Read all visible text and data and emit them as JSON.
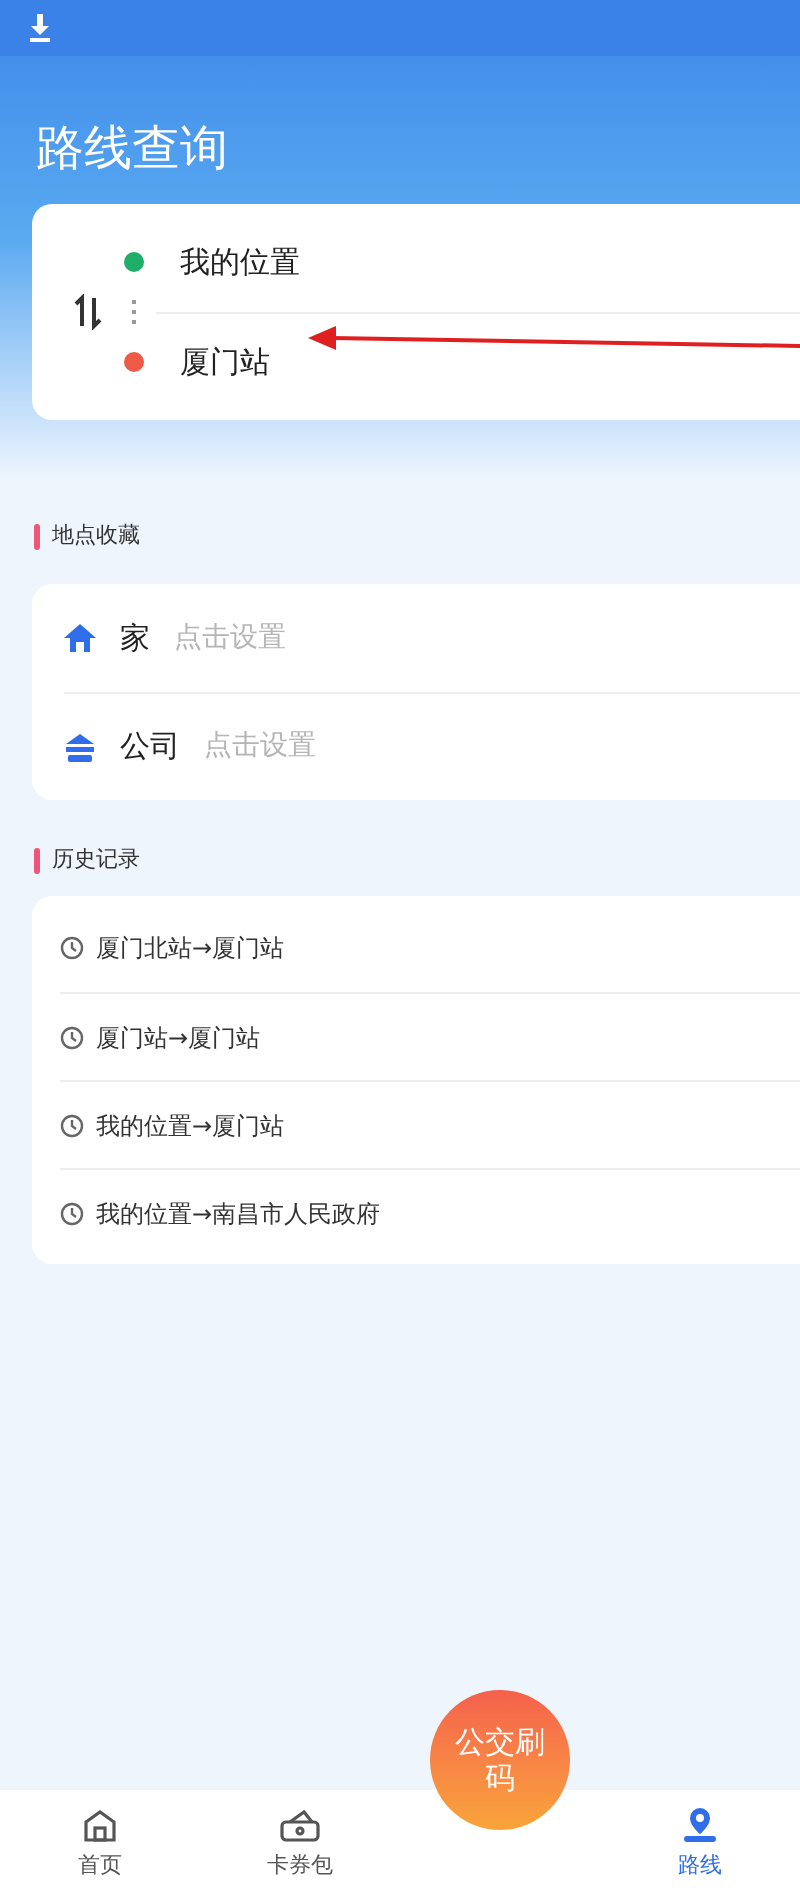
{
  "title": "路线查询",
  "route": {
    "from": "我的位置",
    "to": "厦门站"
  },
  "favorites": {
    "heading": "地点收藏",
    "items": [
      {
        "kind": "home",
        "label": "家",
        "placeholder": "点击设置"
      },
      {
        "kind": "company",
        "label": "公司",
        "placeholder": "点击设置"
      }
    ]
  },
  "history": {
    "heading": "历史记录",
    "items": [
      "厦门北站→厦门站",
      "厦门站→厦门站",
      "我的位置→厦门站",
      "我的位置→南昌市人民政府"
    ]
  },
  "bottom_nav": {
    "items": [
      {
        "kind": "home",
        "label": "首页",
        "selected": false
      },
      {
        "kind": "wallet",
        "label": "卡券包",
        "selected": false
      },
      {
        "kind": "center",
        "label": "公交刷码",
        "selected": false
      },
      {
        "kind": "route",
        "label": "路线",
        "selected": true
      }
    ]
  }
}
